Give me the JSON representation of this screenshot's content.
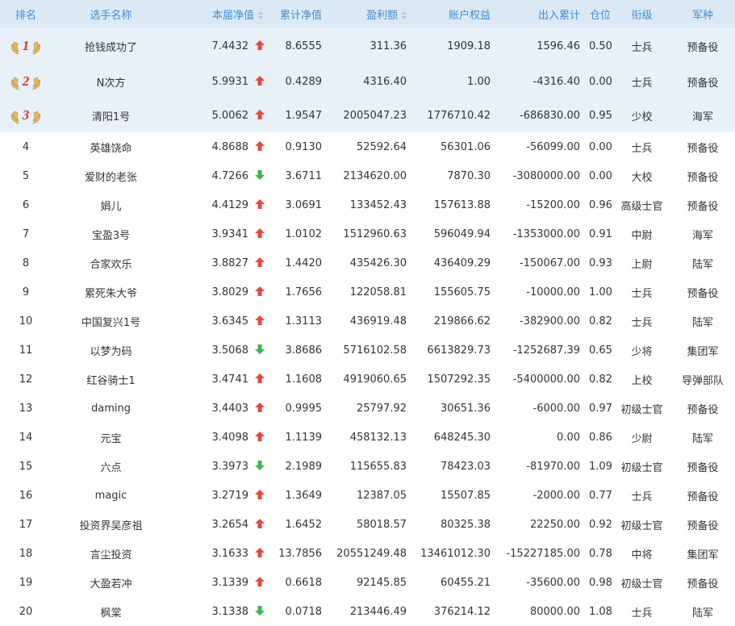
{
  "colors": {
    "header_bg": "#dbe9f7",
    "header_text": "#3d8fd6",
    "up": "#e8463f",
    "down": "#3bb64a",
    "top_row_bg": "#e8f0f8"
  },
  "headers": {
    "rank": "排名",
    "name": "选手名称",
    "nav": "本届净值",
    "cum_nav": "累计净值",
    "profit": "盈利额",
    "equity": "账户权益",
    "net_flow": "出入累计",
    "position": "仓位",
    "title": "衔级",
    "branch": "军种"
  },
  "rows": [
    {
      "rank": "1",
      "medal": true,
      "name": "抢钱成功了",
      "nav": "7.4432",
      "trend": "up",
      "cum_nav": "8.6555",
      "profit": "311.36",
      "equity": "1909.18",
      "net_flow": "1596.46",
      "position": "0.50",
      "title": "士兵",
      "branch": "预备役"
    },
    {
      "rank": "2",
      "medal": true,
      "name": "N次方",
      "nav": "5.9931",
      "trend": "up",
      "cum_nav": "0.4289",
      "profit": "4316.40",
      "equity": "1.00",
      "net_flow": "-4316.40",
      "position": "0.00",
      "title": "士兵",
      "branch": "预备役"
    },
    {
      "rank": "3",
      "medal": true,
      "name": "清阳1号",
      "nav": "5.0062",
      "trend": "up",
      "cum_nav": "1.9547",
      "profit": "2005047.23",
      "equity": "1776710.42",
      "net_flow": "-686830.00",
      "position": "0.95",
      "title": "少校",
      "branch": "海军"
    },
    {
      "rank": "4",
      "name": "英雄饶命",
      "nav": "4.8688",
      "trend": "up",
      "cum_nav": "0.9130",
      "profit": "52592.64",
      "equity": "56301.06",
      "net_flow": "-56099.00",
      "position": "0.00",
      "title": "士兵",
      "branch": "预备役"
    },
    {
      "rank": "5",
      "name": "爱财的老张",
      "nav": "4.7266",
      "trend": "down",
      "cum_nav": "3.6711",
      "profit": "2134620.00",
      "equity": "7870.30",
      "net_flow": "-3080000.00",
      "position": "0.00",
      "title": "大校",
      "branch": "预备役"
    },
    {
      "rank": "6",
      "name": "娟儿",
      "nav": "4.4129",
      "trend": "up",
      "cum_nav": "3.0691",
      "profit": "133452.43",
      "equity": "157613.88",
      "net_flow": "-15200.00",
      "position": "0.96",
      "title": "高级士官",
      "branch": "预备役"
    },
    {
      "rank": "7",
      "name": "宝盈3号",
      "nav": "3.9341",
      "trend": "up",
      "cum_nav": "1.0102",
      "profit": "1512960.63",
      "equity": "596049.94",
      "net_flow": "-1353000.00",
      "position": "0.91",
      "title": "中尉",
      "branch": "海军"
    },
    {
      "rank": "8",
      "name": "合家欢乐",
      "nav": "3.8827",
      "trend": "up",
      "cum_nav": "1.4420",
      "profit": "435426.30",
      "equity": "436409.29",
      "net_flow": "-150067.00",
      "position": "0.93",
      "title": "上尉",
      "branch": "陆军"
    },
    {
      "rank": "9",
      "name": "累死朱大爷",
      "nav": "3.8029",
      "trend": "up",
      "cum_nav": "1.7656",
      "profit": "122058.81",
      "equity": "155605.75",
      "net_flow": "-10000.00",
      "position": "1.00",
      "title": "士兵",
      "branch": "预备役"
    },
    {
      "rank": "10",
      "name": "中国复兴1号",
      "nav": "3.6345",
      "trend": "up",
      "cum_nav": "1.3113",
      "profit": "436919.48",
      "equity": "219866.62",
      "net_flow": "-382900.00",
      "position": "0.82",
      "title": "士兵",
      "branch": "陆军"
    },
    {
      "rank": "11",
      "name": "以梦为码",
      "nav": "3.5068",
      "trend": "down",
      "cum_nav": "3.8686",
      "profit": "5716102.58",
      "equity": "6613829.73",
      "net_flow": "-1252687.39",
      "position": "0.65",
      "title": "少将",
      "branch": "集团军"
    },
    {
      "rank": "12",
      "name": "红谷骑士1",
      "nav": "3.4741",
      "trend": "up",
      "cum_nav": "1.1608",
      "profit": "4919060.65",
      "equity": "1507292.35",
      "net_flow": "-5400000.00",
      "position": "0.82",
      "title": "上校",
      "branch": "导弹部队"
    },
    {
      "rank": "13",
      "name": "daming",
      "nav": "3.4403",
      "trend": "up",
      "cum_nav": "0.9995",
      "profit": "25797.92",
      "equity": "30651.36",
      "net_flow": "-6000.00",
      "position": "0.97",
      "title": "初级士官",
      "branch": "预备役"
    },
    {
      "rank": "14",
      "name": "元宝",
      "nav": "3.4098",
      "trend": "up",
      "cum_nav": "1.1139",
      "profit": "458132.13",
      "equity": "648245.30",
      "net_flow": "0.00",
      "position": "0.86",
      "title": "少尉",
      "branch": "陆军"
    },
    {
      "rank": "15",
      "name": "六点",
      "nav": "3.3973",
      "trend": "down",
      "cum_nav": "2.1989",
      "profit": "115655.83",
      "equity": "78423.03",
      "net_flow": "-81970.00",
      "position": "1.09",
      "title": "初级士官",
      "branch": "预备役"
    },
    {
      "rank": "16",
      "name": "magic",
      "nav": "3.2719",
      "trend": "up",
      "cum_nav": "1.3649",
      "profit": "12387.05",
      "equity": "15507.85",
      "net_flow": "-2000.00",
      "position": "0.77",
      "title": "士兵",
      "branch": "预备役"
    },
    {
      "rank": "17",
      "name": "投资界吴彦祖",
      "nav": "3.2654",
      "trend": "up",
      "cum_nav": "1.6452",
      "profit": "58018.57",
      "equity": "80325.38",
      "net_flow": "22250.00",
      "position": "0.92",
      "title": "初级士官",
      "branch": "预备役"
    },
    {
      "rank": "18",
      "name": "言尘投资",
      "nav": "3.1633",
      "trend": "up",
      "cum_nav": "13.7856",
      "profit": "20551249.48",
      "equity": "13461012.30",
      "net_flow": "-15227185.00",
      "position": "0.78",
      "title": "中将",
      "branch": "集团军"
    },
    {
      "rank": "19",
      "name": "大盈若冲",
      "nav": "3.1339",
      "trend": "up",
      "cum_nav": "0.6618",
      "profit": "92145.85",
      "equity": "60455.21",
      "net_flow": "-35600.00",
      "position": "0.98",
      "title": "初级士官",
      "branch": "预备役"
    },
    {
      "rank": "20",
      "name": "枫棠",
      "nav": "3.1338",
      "trend": "down",
      "cum_nav": "0.0718",
      "profit": "213446.49",
      "equity": "376214.12",
      "net_flow": "80000.00",
      "position": "1.08",
      "title": "士兵",
      "branch": "陆军"
    }
  ]
}
